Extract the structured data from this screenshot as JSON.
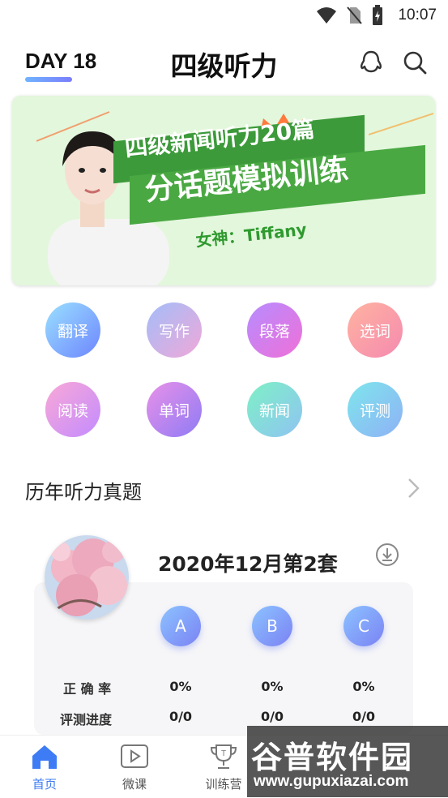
{
  "status_bar": {
    "time": "10:07"
  },
  "header": {
    "day": "DAY 18",
    "title": "四级听力"
  },
  "banner": {
    "line1": "四级新闻听力20篇",
    "line2": "分话题模拟训练",
    "line3": "女神：Tiffany"
  },
  "categories": [
    {
      "label": "翻译",
      "colors": [
        "#9ae0ff",
        "#6e86ff"
      ]
    },
    {
      "label": "写作",
      "colors": [
        "#a3bdf9",
        "#f0a8d8"
      ]
    },
    {
      "label": "段落",
      "colors": [
        "#b68cff",
        "#f070d8"
      ]
    },
    {
      "label": "选词",
      "colors": [
        "#ffb3a0",
        "#f58ab0"
      ]
    },
    {
      "label": "阅读",
      "colors": [
        "#f9a8d6",
        "#c38cff"
      ]
    },
    {
      "label": "单词",
      "colors": [
        "#e891e8",
        "#8f7bf5"
      ]
    },
    {
      "label": "新闻",
      "colors": [
        "#7ef0c6",
        "#8fc4f2"
      ]
    },
    {
      "label": "评测",
      "colors": [
        "#7ee6ec",
        "#8fb1f6"
      ]
    }
  ],
  "section": {
    "title": "历年听力真题"
  },
  "exam": {
    "title": "2020年12月第2套",
    "options": [
      "A",
      "B",
      "C"
    ],
    "row_labels": [
      "正 确 率",
      "评测进度"
    ],
    "accuracy": [
      "0%",
      "0%",
      "0%"
    ],
    "progress": [
      "0/0",
      "0/0",
      "0/0"
    ]
  },
  "nav": {
    "items": [
      "首页",
      "微课",
      "训练营"
    ],
    "active_color": "#3d7cf5"
  },
  "watermark": {
    "line1": "谷普软件园",
    "line2": "www.gupuxiazai.com"
  }
}
